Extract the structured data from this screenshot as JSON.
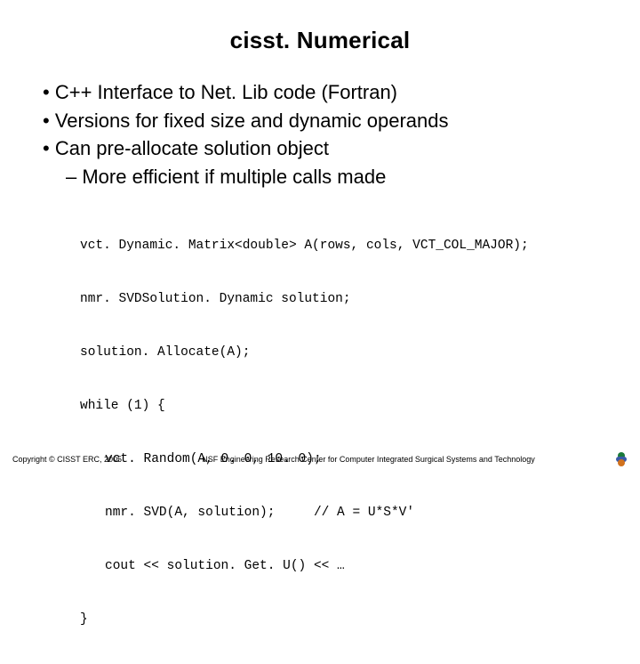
{
  "title": "cisst. Numerical",
  "bullets": [
    {
      "level": 1,
      "text": "C++ Interface to Net. Lib code (Fortran)"
    },
    {
      "level": 1,
      "text": "Versions for fixed size and dynamic operands"
    },
    {
      "level": 1,
      "text": "Can pre-allocate solution object"
    },
    {
      "level": 2,
      "text": "More efficient if multiple calls made"
    }
  ],
  "code": [
    {
      "i": 0,
      "t": "vct. Dynamic. Matrix<double> A(rows, cols, VCT_COL_MAJOR);"
    },
    {
      "i": 0,
      "t": "nmr. SVDSolution. Dynamic solution;"
    },
    {
      "i": 0,
      "t": "solution. Allocate(A);"
    },
    {
      "i": 0,
      "t": "while (1) {"
    },
    {
      "i": 1,
      "t": "vct. Random(A, 0. 0, 10. 0);"
    },
    {
      "i": 1,
      "t": "nmr. SVD(A, solution);     // A = U*S*V'"
    },
    {
      "i": 1,
      "t": "cout << solution. Get. U() << …"
    },
    {
      "i": 0,
      "t": "}"
    }
  ],
  "footer": {
    "copyright": "Copyright © CISST ERC, 2005",
    "center": "NSF Engineering Research Center for Computer Integrated Surgical Systems and Technology"
  }
}
